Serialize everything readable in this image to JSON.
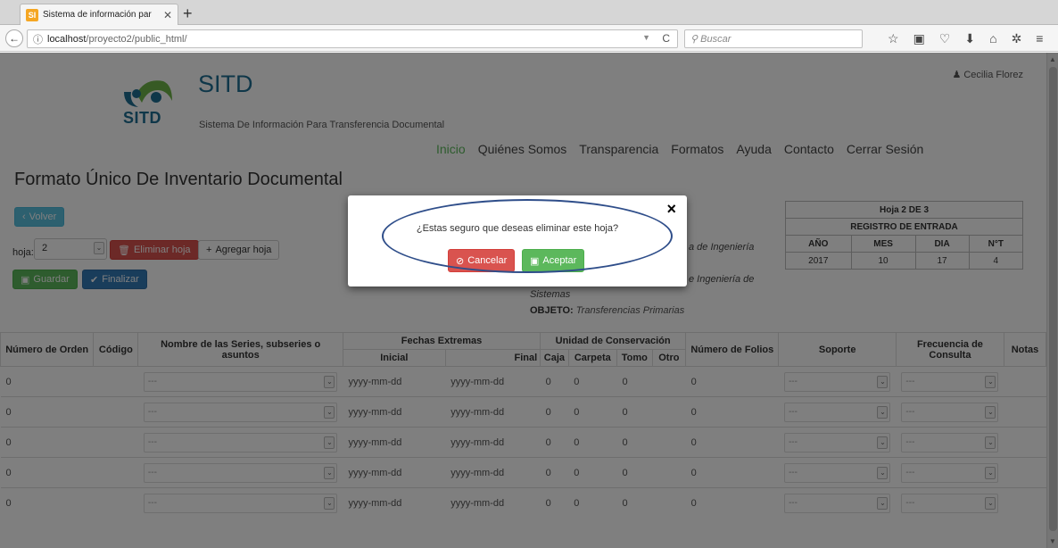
{
  "browser": {
    "tab_title": "Sistema de información par",
    "tab_favicon": "SI",
    "url_host": "localhost",
    "url_path": "/proyecto2/public_html/",
    "search_placeholder": "Buscar"
  },
  "header": {
    "logo_text": "SITD",
    "title": "SITD",
    "subtitle": "Sistema De Información Para Transferencia Documental",
    "user": "Cecilia Florez"
  },
  "menu": [
    "Inicio",
    "Quiénes Somos",
    "Transparencia",
    "Formatos",
    "Ayuda",
    "Contacto",
    "Cerrar Sesión"
  ],
  "page": {
    "title": "Formato Único De Inventario Documental",
    "back_label": "Volver",
    "hoja_label": "hoja:",
    "hoja_value": "2",
    "delete_label": "Eliminar hoja",
    "add_label": "Agregar hoja",
    "save_label": "Guardar",
    "finish_label": "Finalizar",
    "info_1": "a de Ingeniería",
    "info_2": "e Ingeniería de",
    "info_3": "Sistemas",
    "objeto_label": "OBJETO:",
    "objeto_value": "Transferencias Primarias"
  },
  "registro": {
    "hoja": "Hoja 2 DE 3",
    "heading": "REGISTRO DE ENTRADA",
    "cols": [
      "AÑO",
      "MES",
      "DIA",
      "N°T"
    ],
    "values": [
      "2017",
      "10",
      "17",
      "4"
    ]
  },
  "grid": {
    "headers": {
      "orden": "Número de Orden",
      "codigo": "Código",
      "nombre": "Nombre de las Series, subseries o asuntos",
      "fechas": "Fechas Extremas",
      "inicial": "Inicial",
      "final": "Final",
      "unidad": "Unidad de Conservación",
      "caja": "Caja",
      "carpeta": "Carpeta",
      "tomo": "Tomo",
      "otro": "Otro",
      "folios": "Número de Folios",
      "soporte": "Soporte",
      "frecuencia": "Frecuencia de Consulta",
      "notas": "Notas"
    },
    "rows": [
      {
        "orden": "0",
        "nombre": "---",
        "inicial": "yyyy-mm-dd",
        "final": "yyyy-mm-dd",
        "caja": "0",
        "carpeta": "0",
        "tomo": "0",
        "folios": "0",
        "soporte": "---",
        "frecuencia": "---"
      },
      {
        "orden": "0",
        "nombre": "---",
        "inicial": "yyyy-mm-dd",
        "final": "yyyy-mm-dd",
        "caja": "0",
        "carpeta": "0",
        "tomo": "0",
        "folios": "0",
        "soporte": "---",
        "frecuencia": "---"
      },
      {
        "orden": "0",
        "nombre": "---",
        "inicial": "yyyy-mm-dd",
        "final": "yyyy-mm-dd",
        "caja": "0",
        "carpeta": "0",
        "tomo": "0",
        "folios": "0",
        "soporte": "---",
        "frecuencia": "---"
      },
      {
        "orden": "0",
        "nombre": "---",
        "inicial": "yyyy-mm-dd",
        "final": "yyyy-mm-dd",
        "caja": "0",
        "carpeta": "0",
        "tomo": "0",
        "folios": "0",
        "soporte": "---",
        "frecuencia": "---"
      },
      {
        "orden": "0",
        "nombre": "---",
        "inicial": "yyyy-mm-dd",
        "final": "yyyy-mm-dd",
        "caja": "0",
        "carpeta": "0",
        "tomo": "0",
        "folios": "0",
        "soporte": "---",
        "frecuencia": "---"
      }
    ]
  },
  "modal": {
    "message": "¿Estas seguro que deseas eliminar este hoja?",
    "cancel_label": "Cancelar",
    "accept_label": "Aceptar",
    "close_glyph": "×"
  },
  "colors": {
    "brand": "#1f6e93",
    "menu_active": "#5cb85c",
    "danger": "#d9534f",
    "success": "#5cb85c",
    "annotation": "#2f4e8a"
  },
  "icons": [
    "favicon-icon",
    "close-tab-icon",
    "new-tab-icon",
    "back-icon",
    "info-icon",
    "reload-icon",
    "search-icon",
    "star-icon",
    "clipboard-icon",
    "pocket-icon",
    "download-icon",
    "home-icon",
    "extension-icon",
    "hamburger-icon",
    "user-icon",
    "chevron-left-icon",
    "trash-icon",
    "plus-icon",
    "save-icon",
    "check-icon",
    "cancel-icon",
    "close-icon"
  ]
}
